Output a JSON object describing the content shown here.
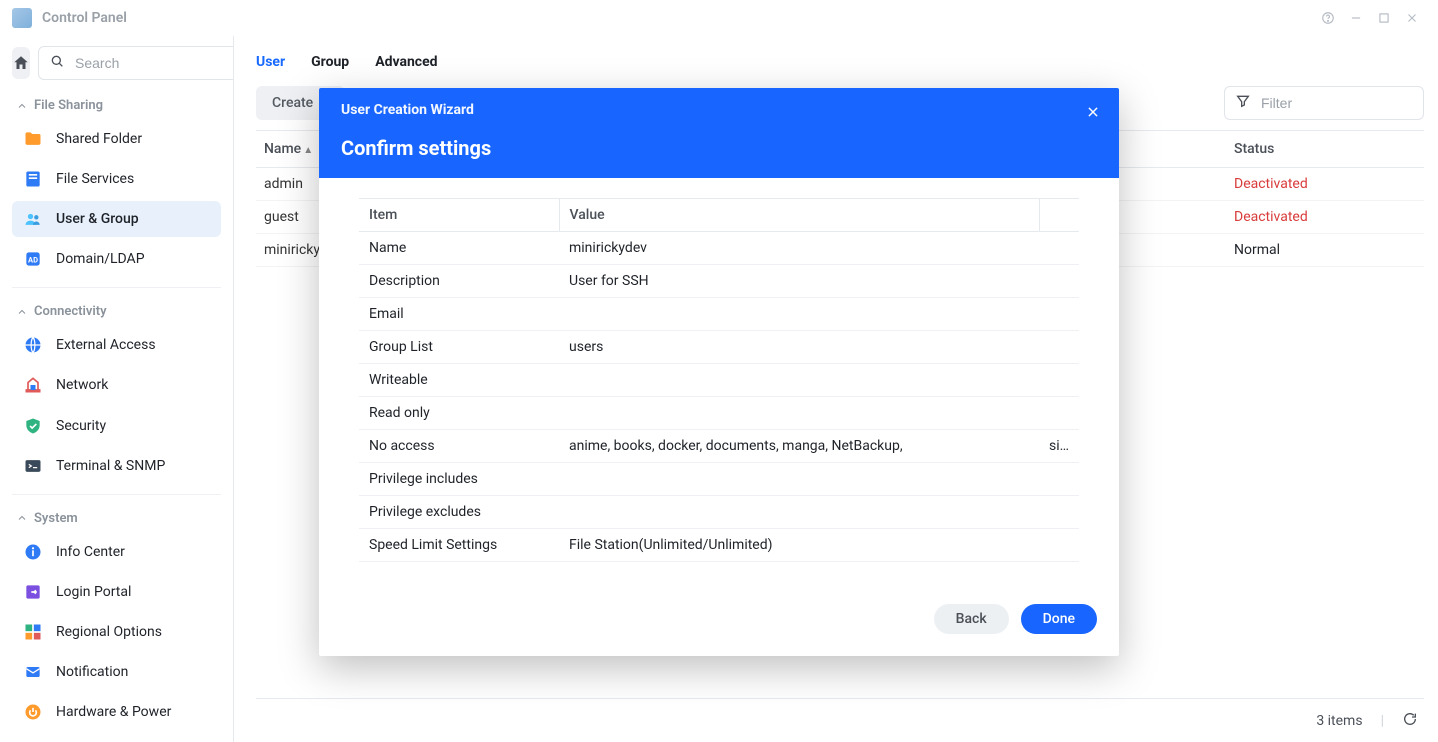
{
  "app": {
    "title": "Control Panel"
  },
  "search": {
    "placeholder": "Search"
  },
  "sections": {
    "file_sharing": {
      "title": "File Sharing"
    },
    "connectivity": {
      "title": "Connectivity"
    },
    "system": {
      "title": "System"
    }
  },
  "sidebar": {
    "shared_folder": "Shared Folder",
    "file_services": "File Services",
    "user_group": "User & Group",
    "domain_ldap": "Domain/LDAP",
    "external_access": "External Access",
    "network": "Network",
    "security": "Security",
    "terminal_snmp": "Terminal & SNMP",
    "info_center": "Info Center",
    "login_portal": "Login Portal",
    "regional_options": "Regional Options",
    "notification": "Notification",
    "hardware_power": "Hardware & Power"
  },
  "tabs": {
    "user": "User",
    "group": "Group",
    "advanced": "Advanced"
  },
  "toolbar": {
    "create": "Create"
  },
  "filter": {
    "placeholder": "Filter"
  },
  "table": {
    "columns": {
      "name": "Name",
      "status": "Status"
    },
    "rows": [
      {
        "name": "admin",
        "status": "Deactivated",
        "status_class": "status-deactivated"
      },
      {
        "name": "guest",
        "status": "Deactivated",
        "status_class": "status-deactivated"
      },
      {
        "name": "minirickydev",
        "status": "Normal",
        "status_class": "status-normal"
      }
    ]
  },
  "footer": {
    "count_text": "3 items"
  },
  "modal": {
    "wizard_title": "User Creation Wizard",
    "step_title": "Confirm settings",
    "columns": {
      "item": "Item",
      "value": "Value"
    },
    "rows": [
      {
        "item": "Name",
        "value": "minirickydev",
        "extra": ""
      },
      {
        "item": "Description",
        "value": "User for SSH",
        "extra": ""
      },
      {
        "item": "Email",
        "value": "",
        "extra": ""
      },
      {
        "item": "Group List",
        "value": "users",
        "extra": ""
      },
      {
        "item": "Writeable",
        "value": "",
        "extra": ""
      },
      {
        "item": "Read only",
        "value": "",
        "extra": ""
      },
      {
        "item": "No access",
        "value": "anime, books, docker, documents, manga, NetBackup,",
        "extra": "si…"
      },
      {
        "item": "Privilege includes",
        "value": "",
        "extra": ""
      },
      {
        "item": "Privilege excludes",
        "value": "",
        "extra": ""
      },
      {
        "item": "Speed Limit Settings",
        "value": "File Station(Unlimited/Unlimited)",
        "extra": ""
      }
    ],
    "buttons": {
      "back": "Back",
      "done": "Done"
    }
  }
}
